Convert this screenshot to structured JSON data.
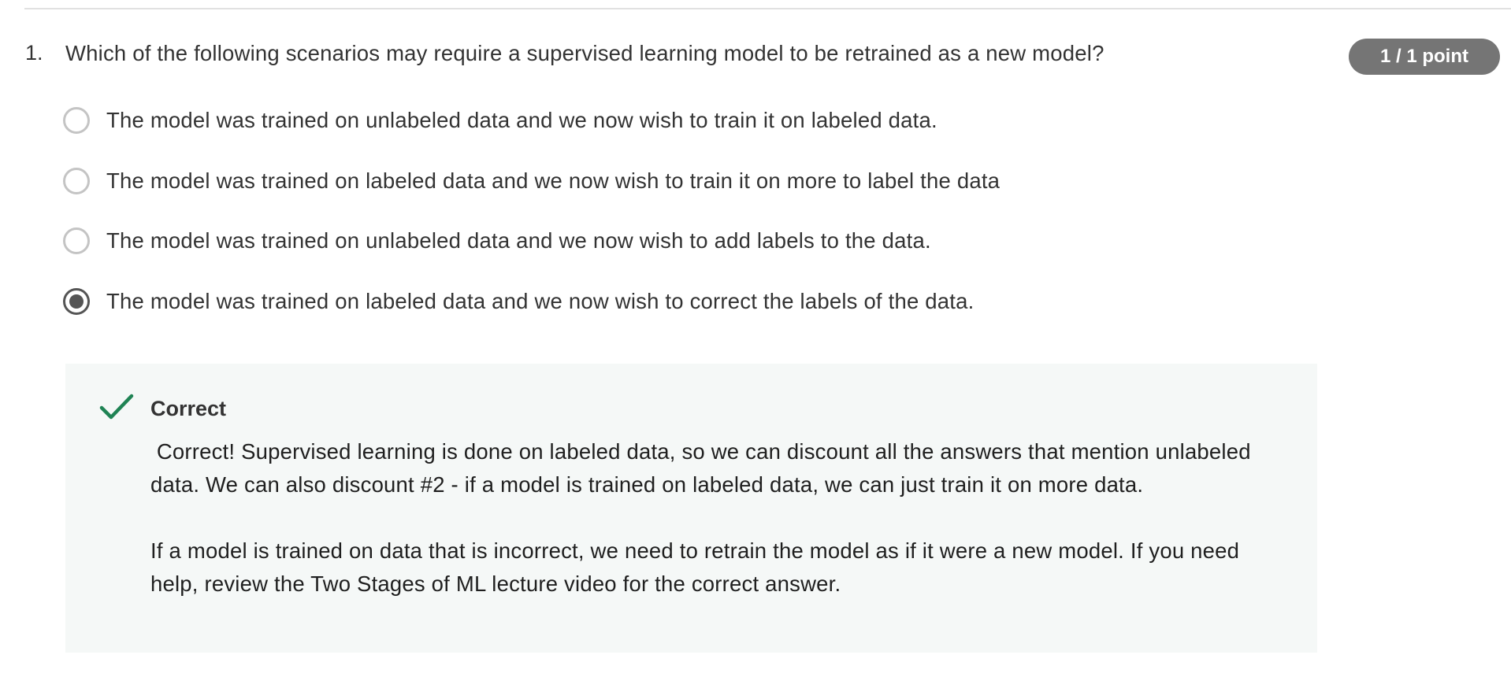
{
  "question": {
    "number": "1.",
    "text": "Which of the following scenarios may require a supervised learning model to be retrained as a new model?",
    "score": "1 / 1 point",
    "options": [
      {
        "label": "The model was trained on unlabeled data and we now wish to train it on labeled data.",
        "selected": false
      },
      {
        "label": "The model was trained on labeled data and we now wish to train it on more to  label the data",
        "selected": false
      },
      {
        "label": "The model was trained on unlabeled data and we now wish to add labels to the data.",
        "selected": false
      },
      {
        "label": "The model was trained on labeled data and we now wish to correct the labels of the data.",
        "selected": true
      }
    ]
  },
  "feedback": {
    "icon": "checkmark-icon",
    "status_color": "#1f8354",
    "title": "Correct",
    "paragraphs": [
      " Correct! Supervised learning is done on labeled data, so we can discount all the answers that mention unlabeled data. We can also discount #2 - if a model is trained on labeled data, we can just train it on more data.",
      "If a model is trained on data that is incorrect, we need to retrain the model as if it were a new model. If you need help, review the Two Stages of ML lecture video for the correct answer."
    ]
  }
}
